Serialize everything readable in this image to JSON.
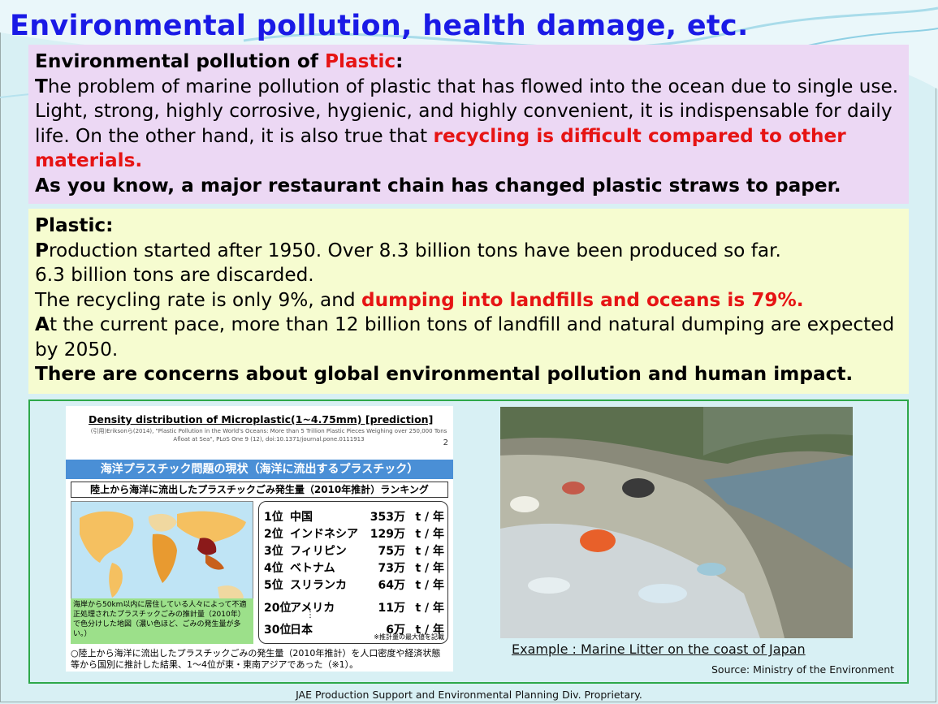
{
  "title": "Environmental pollution, health damage, etc.",
  "box1": {
    "heading_prefix": "Environmental pollution of ",
    "heading_word": "Plastic",
    "heading_suffix": ":",
    "p1_lead": "T",
    "p1_text": "he problem of marine pollution of plastic that has flowed into the ocean due to single use. Light, strong, highly corrosive, hygienic, and highly convenient, it is indispensable for daily life. On the other hand, it is also true that ",
    "p1_red": "recycling is difficult compared to other materials.",
    "p2": "As you know, a major restaurant chain has changed plastic straws to paper."
  },
  "box2": {
    "heading": "Plastic:",
    "p1_lead": "P",
    "p1_text": "roduction started after 1950. Over 8.3 billion tons have been produced so far.",
    "p2": "6.3 billion tons are discarded.",
    "p3_text": "The recycling rate is only 9%, and ",
    "p3_red": "dumping into landfills and oceans is 79%.",
    "p4_lead": "A",
    "p4_text": "t the current pace, more than 12 billion tons of landfill and natural dumping are expected by 2050.",
    "p5": "There are concerns about global environmental pollution and human impact."
  },
  "slide": {
    "title": "Density distribution of Microplastic(1~4.75mm)    [prediction]",
    "cite": "(引用)Eriksonら(2014), \"Plastic Pollution in the World's Oceans: More than 5 Trillion Plastic Pieces Weighing over 250,000 Tons Afloat at Sea\", PLoS One 9 (12), doi:10.1371/journal.pone.0111913",
    "page_number": "2",
    "band": "海洋プラスチック問題の現状（海洋に流出するプラスチック）",
    "subheading": "陸上から海洋に流出したプラスチックごみ発生量（2010年推計）ランキング",
    "map_note": "海岸から50km以内に居住している人々によって不適正処理されたプラスチックごみの推計量（2010年）で色分けした地図（濃い色ほど、ごみの発生量が多い。）",
    "ranking": [
      {
        "rank": "1位",
        "country": "中国",
        "value": "353万",
        "unit": "t / 年"
      },
      {
        "rank": "2位",
        "country": "インドネシア",
        "value": "129万",
        "unit": "t / 年"
      },
      {
        "rank": "3位",
        "country": "フィリピン",
        "value": "75万",
        "unit": "t / 年"
      },
      {
        "rank": "4位",
        "country": "ベトナム",
        "value": "73万",
        "unit": "t / 年"
      },
      {
        "rank": "5位",
        "country": "スリランカ",
        "value": "64万",
        "unit": "t / 年"
      },
      {
        "rank": "20位",
        "country": "アメリカ",
        "value": "11万",
        "unit": "t / 年"
      },
      {
        "rank": "30位",
        "country": "日本",
        "value": "6万",
        "unit": "t / 年"
      }
    ],
    "ellipsis": "⋮",
    "rank_note": "※推計量の最大値を記載",
    "footnote": "○陸上から海洋に流出したプラスチックごみの発生量（2010年推計）を人口密度や経済状態等から国別に推計した結果、1～4位が東・東南アジアであった（※1）。"
  },
  "photo_caption": "Example : Marine Litter on the coast of Japan",
  "source": "Source: Ministry of the Environment",
  "footer": "JAE Production Support and Environmental Planning Div. Proprietary."
}
